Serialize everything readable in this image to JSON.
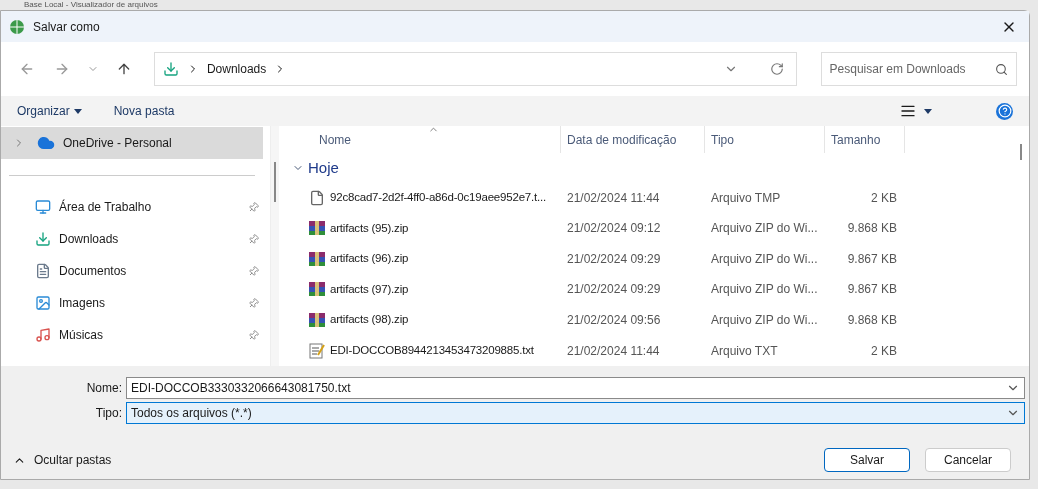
{
  "background_window": {
    "title": "Base Local - Visualizador de arquivos"
  },
  "dialog": {
    "title": "Salvar como"
  },
  "address_bar": {
    "crumbs": [
      "Downloads"
    ]
  },
  "search": {
    "placeholder": "Pesquisar em Downloads"
  },
  "toolbar": {
    "organize": "Organizar",
    "new_folder": "Nova pasta"
  },
  "sidebar": {
    "items": [
      {
        "label": "OneDrive - Personal",
        "kind": "cloud",
        "selected": true,
        "pinned": false
      },
      {
        "label": "Área de Trabalho",
        "kind": "desktop",
        "selected": false,
        "pinned": true
      },
      {
        "label": "Downloads",
        "kind": "download",
        "selected": false,
        "pinned": true
      },
      {
        "label": "Documentos",
        "kind": "documents",
        "selected": false,
        "pinned": true
      },
      {
        "label": "Imagens",
        "kind": "pictures",
        "selected": false,
        "pinned": true
      },
      {
        "label": "Músicas",
        "kind": "music",
        "selected": false,
        "pinned": true
      }
    ]
  },
  "table": {
    "columns": [
      "Nome",
      "Data de modificação",
      "Tipo",
      "Tamanho"
    ],
    "group": {
      "label": "Hoje",
      "expanded": true
    },
    "rows": [
      {
        "name": "92c8cad7-2d2f-4ff0-a86d-0c19aee952e7.t...",
        "kind": "file",
        "date": "21/02/2024 11:44",
        "type": "Arquivo TMP",
        "size": "2 KB"
      },
      {
        "name": "artifacts (95).zip",
        "kind": "zip",
        "date": "21/02/2024 09:12",
        "type": "Arquivo ZIP do Wi...",
        "size": "9.868 KB"
      },
      {
        "name": "artifacts (96).zip",
        "kind": "zip",
        "date": "21/02/2024 09:29",
        "type": "Arquivo ZIP do Wi...",
        "size": "9.867 KB"
      },
      {
        "name": "artifacts (97).zip",
        "kind": "zip",
        "date": "21/02/2024 09:29",
        "type": "Arquivo ZIP do Wi...",
        "size": "9.867 KB"
      },
      {
        "name": "artifacts (98).zip",
        "kind": "zip",
        "date": "21/02/2024 09:56",
        "type": "Arquivo ZIP do Wi...",
        "size": "9.868 KB"
      },
      {
        "name": "EDI-DOCCOB8944213453473209885.txt",
        "kind": "txt",
        "date": "21/02/2024 11:44",
        "type": "Arquivo TXT",
        "size": "2 KB"
      }
    ]
  },
  "form": {
    "name_label": "Nome:",
    "name_value": "EDI-DOCCOB3330332066643081750.txt",
    "type_label": "Tipo:",
    "type_value": "Todos os arquivos (*.*)"
  },
  "footer": {
    "hide_folders": "Ocultar pastas",
    "buttons": [
      "Salvar",
      "Cancelar"
    ]
  }
}
